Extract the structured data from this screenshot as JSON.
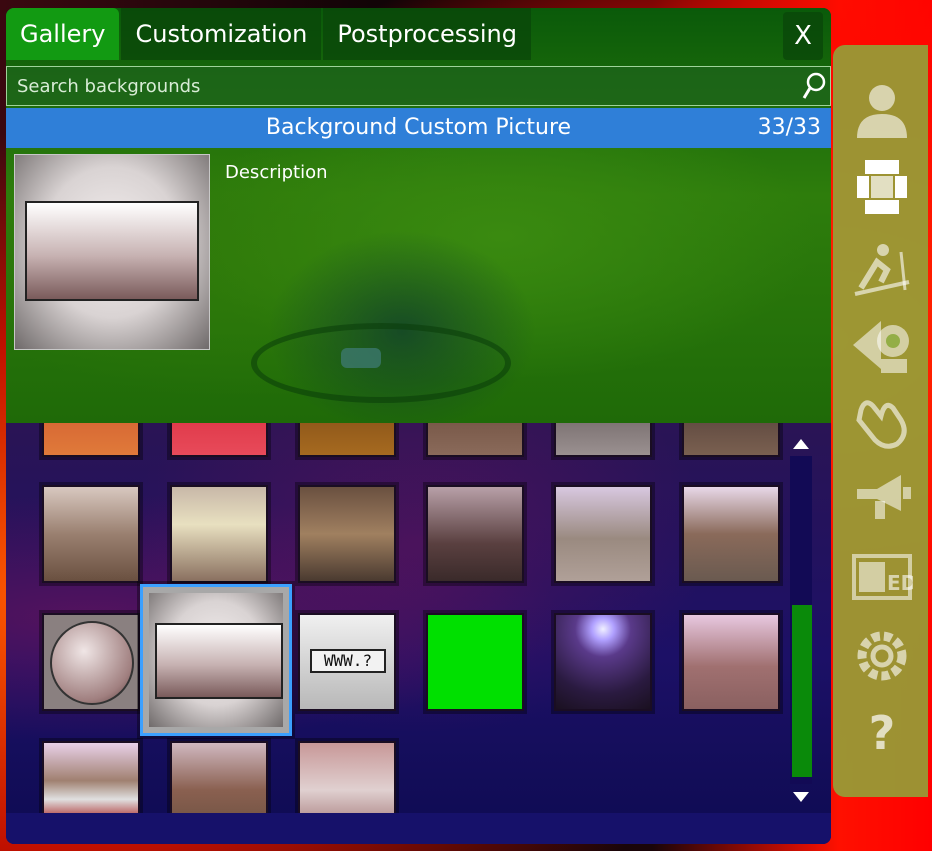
{
  "tabs": [
    {
      "label": "Gallery",
      "active": true
    },
    {
      "label": "Customization",
      "active": false
    },
    {
      "label": "Postprocessing",
      "active": false
    }
  ],
  "close_label": "X",
  "search": {
    "placeholder": "Search backgrounds",
    "value": ""
  },
  "selected_item": {
    "name": "Background Custom Picture",
    "counter": "33/33"
  },
  "description_label": "Description",
  "thumbnails": [
    {
      "kind": "www",
      "text": "WWW.?"
    }
  ],
  "toolbar": {
    "help_label": "?",
    "icons": [
      "person-icon",
      "layout-icon",
      "ski-icon",
      "webcam-icon",
      "hand-icon",
      "megaphone-icon",
      "ed-icon",
      "gear-icon",
      "help-icon"
    ],
    "ed_label": "ED"
  },
  "colors": {
    "tab_active": "#129a12",
    "title_bar": "#2f7fd8",
    "selection_border": "#3ba0ff",
    "scroll_thumb": "#0a8a0a",
    "toolbar": "#8caa3c"
  }
}
